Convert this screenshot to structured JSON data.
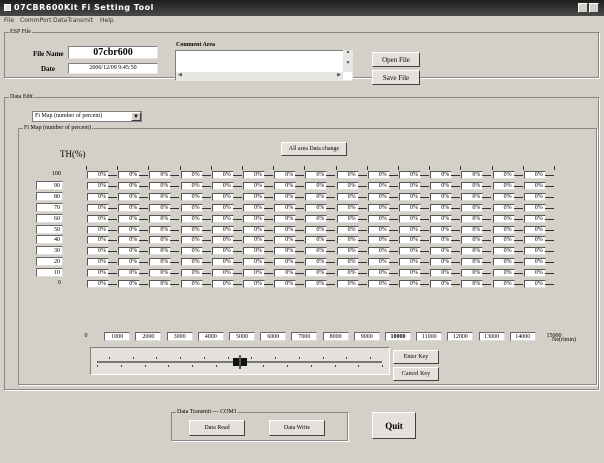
{
  "window": {
    "title": "07CBR600Kit Fi Setting Tool"
  },
  "menu": [
    "File",
    "CommPort",
    "DataTransmit",
    "Help"
  ],
  "esp_file": {
    "legend": "ESP File",
    "file_name_label": "File Name",
    "file_name_value": "07cbr600",
    "date_label": "Date",
    "date_value": "2006/12/09 9:45:50",
    "comment_label": "Comment Area",
    "comment_value": "",
    "open_label": "Open File",
    "save_label": "Save File"
  },
  "data_edit": {
    "legend": "Data Edit",
    "selected": "Fi Map (number of percent)"
  },
  "map": {
    "legend": "Fi Map (number of percent)",
    "th_label": "TH(%)",
    "all_change_label": "All area Data change",
    "rows": [
      "100",
      "90",
      "80",
      "70",
      "60",
      "50",
      "40",
      "30",
      "20",
      "10",
      "0"
    ],
    "cols": [
      "0",
      "1000",
      "2000",
      "3000",
      "4000",
      "5000",
      "6000",
      "7000",
      "8000",
      "9000",
      "10000",
      "11000",
      "12000",
      "13000",
      "14000",
      "15000"
    ],
    "col_unit": "Ne(rlmin)",
    "cell_value": "0%"
  },
  "slider": {
    "value": 0.5
  },
  "enter_label": "Enter Key",
  "cancel_label": "Cancel Key",
  "transmit": {
    "legend": "Data Transmit --- COM1",
    "read_label": "Data Read",
    "write_label": "Data Write"
  },
  "quit_label": "Quit",
  "colors": {
    "title_bg": "#2a2a2a",
    "face": "#d4d0c8"
  }
}
